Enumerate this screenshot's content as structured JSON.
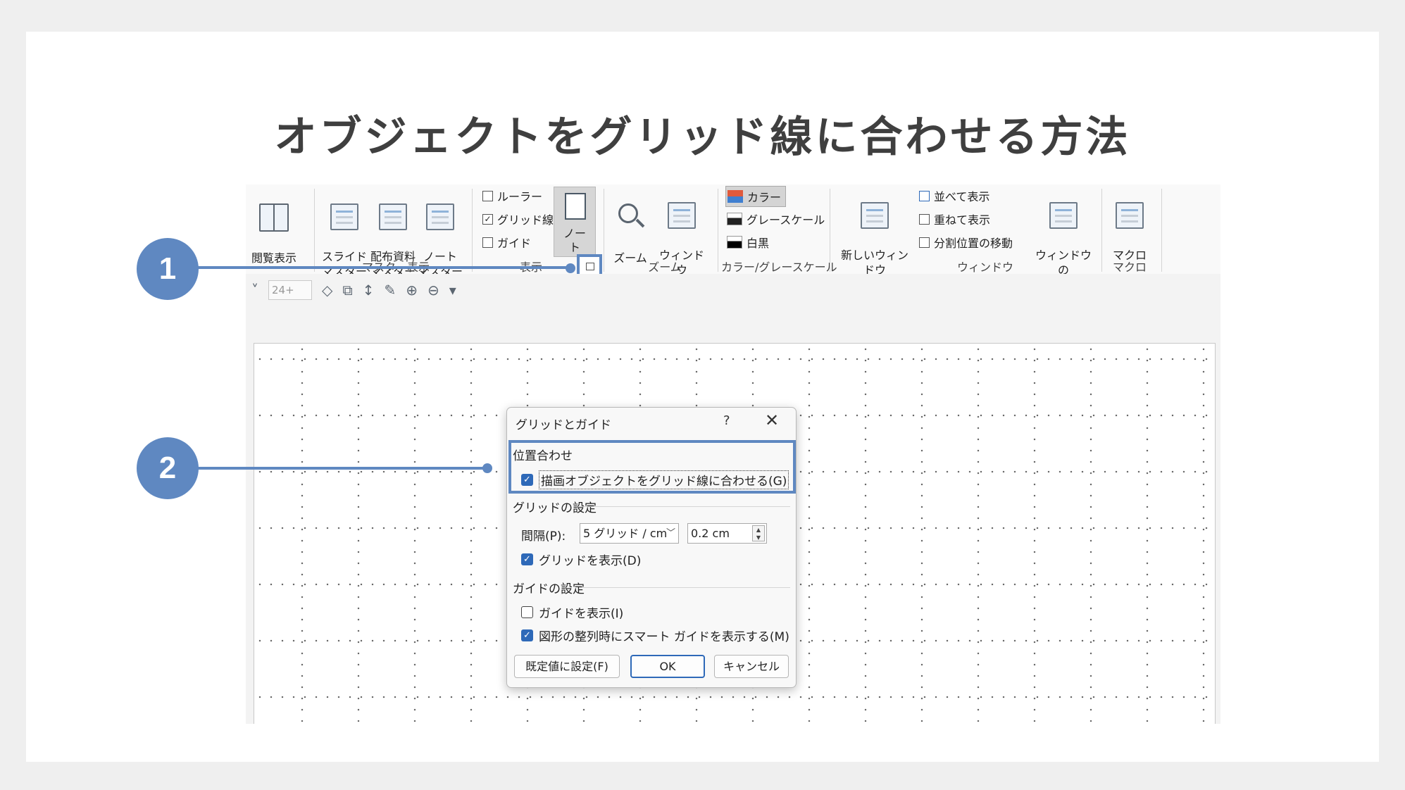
{
  "page_title": "オブジェクトをグリッド線に合わせる方法",
  "ribbon": {
    "reading_view": "閲覧表示",
    "slide_master": "スライド\nマスター",
    "handout_master": "配布資料\nマスター",
    "notes_master": "ノート\nマスター",
    "group_master": "マスター表示",
    "ruler": "ルーラー",
    "gridlines": "グリッド線",
    "guides": "ガイド",
    "notes": "ノー\nト",
    "group_show": "表示",
    "zoom": "ズーム",
    "fit_to_window": "ウィンドウ\nに合わせる",
    "group_zoom": "ズーム",
    "color": "カラー",
    "grayscale": "グレースケール",
    "black_white": "白黒",
    "group_color": "カラー/グレースケール",
    "new_window": "新しいウィンドウ\nを開く",
    "arrange_all": "並べて表示",
    "cascade": "重ねて表示",
    "move_split": "分割位置の移動",
    "switch_windows": "ウィンドウの\n切り替え ˅",
    "group_window": "ウィンドウ",
    "macros": "マクロ",
    "group_macro": "マクロ"
  },
  "toolbar": {
    "font_size": "24+"
  },
  "dialog": {
    "title": "グリッドとガイド",
    "help": "?",
    "close": "✕",
    "section_snap": "位置合わせ",
    "snap_label": "描画オブジェクトをグリッド線に合わせる(G)",
    "section_grid": "グリッドの設定",
    "spacing_label": "間隔(P):",
    "spacing_select": "5 グリッド / cm",
    "spacing_value": "0.2 cm",
    "show_grid": "グリッドを表示(D)",
    "section_guide": "ガイドの設定",
    "show_guides": "ガイドを表示(I)",
    "smart_guides": "図形の整列時にスマート ガイドを表示する(M)",
    "set_default": "既定値に設定(F)",
    "ok": "OK",
    "cancel": "キャンセル"
  },
  "checkboxes": {
    "ruler": false,
    "gridlines": true,
    "guides": false,
    "snap_to_grid": true,
    "show_grid": true,
    "show_guides": false,
    "smart_guides": true
  },
  "callouts": [
    "1",
    "2"
  ],
  "colors": {
    "accent": "#5f88c1",
    "checkbox": "#2e69b8"
  }
}
